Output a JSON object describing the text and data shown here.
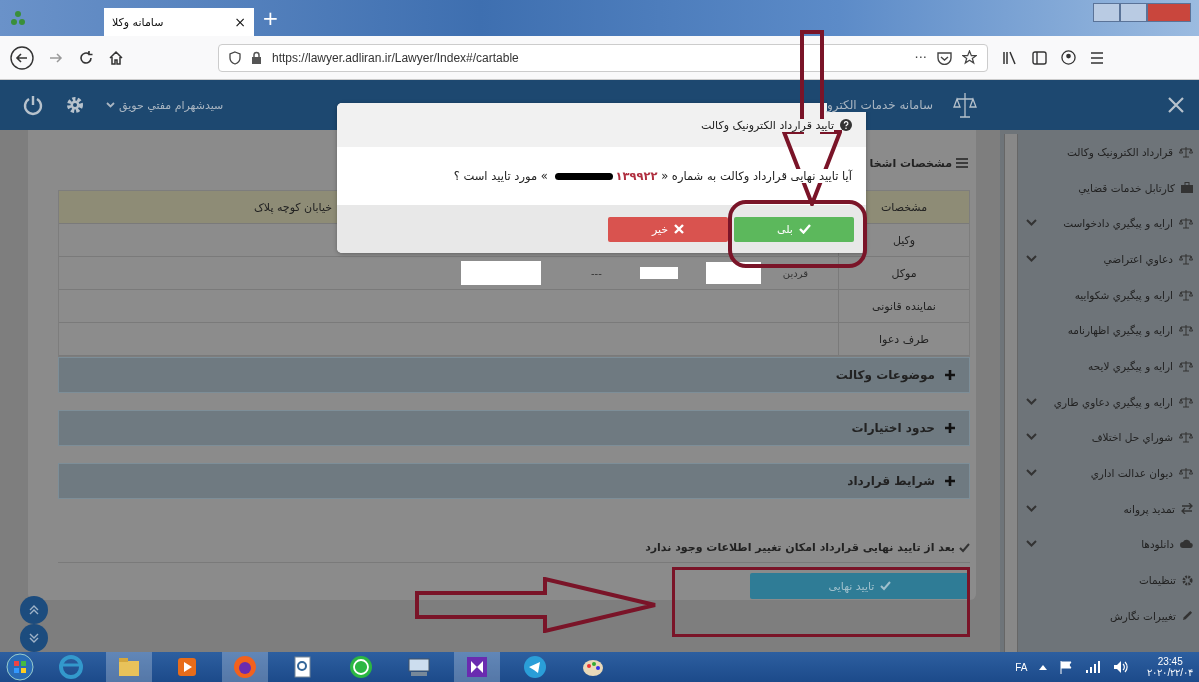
{
  "browser": {
    "tab_title": "سامانه وکلا",
    "tab_close": "×",
    "new_tab": "+",
    "url": "https://lawyer.adliran.ir/Lawyer/Index#/cartable",
    "more": "···"
  },
  "header": {
    "user": "سیدشهرام مفتي حويق",
    "system": "سامانه خدمات الکترو"
  },
  "sidebar": {
    "items": [
      {
        "label": "قرارداد الکترونیک وکالت",
        "kind": "scales",
        "expandable": false
      },
      {
        "label": "کارتابل خدمات قضايي",
        "kind": "briefcase",
        "expandable": false
      },
      {
        "label": "ارايه و پيگيري دادخواست",
        "kind": "scales",
        "expandable": true
      },
      {
        "label": "دعاوي اعتراضي",
        "kind": "scales",
        "expandable": true
      },
      {
        "label": "ارايه و پيگيري شكواييه",
        "kind": "scales",
        "expandable": false
      },
      {
        "label": "ارايه و پيگيري اظهارنامه",
        "kind": "scales",
        "expandable": false
      },
      {
        "label": "ارايه و پيگيري لايحه",
        "kind": "scales",
        "expandable": false
      },
      {
        "label": "ارايه و پيگيري دعاوي طاري",
        "kind": "scales",
        "expandable": true
      },
      {
        "label": "شوراي حل اختلاف",
        "kind": "scales",
        "expandable": true
      },
      {
        "label": "ديوان عدالت اداري",
        "kind": "scales",
        "expandable": true
      },
      {
        "label": "تمدید پروانه",
        "kind": "exchange",
        "expandable": true
      },
      {
        "label": "دانلودها",
        "kind": "cloud",
        "expandable": true
      },
      {
        "label": "تنظیمات",
        "kind": "gear",
        "expandable": false
      },
      {
        "label": "تغییرات نگارش",
        "kind": "pencil",
        "expandable": false
      }
    ]
  },
  "panel": {
    "title": "مشخصات اشخا",
    "columns": [
      "مشخصات",
      "خیابان کوچه پلاک"
    ],
    "rows": [
      {
        "label": "وکیل",
        "cells": []
      },
      {
        "label": "موکل",
        "cells": [
          "قردین",
          "---"
        ]
      },
      {
        "label": "نماینده قانونی",
        "cells": []
      },
      {
        "label": "طرف دعوا",
        "cells": []
      }
    ]
  },
  "sections": [
    "موضوعات وکالت",
    "حدود اختیارات",
    "شرایط قرارداد"
  ],
  "note": "بعد از تایید نهایی قرارداد امکان تغییر اطلاعات وجود ندارد",
  "final_button": {
    "label": "تایید نهایی",
    "disabled": true
  },
  "dialog": {
    "title": "تایید قرارداد الکترونیک وکالت",
    "message_before": "آیا تایید نهایی قرارداد وکالت به شماره «",
    "number": "۱۳۹۹۲۲",
    "message_after": "» مورد تایید است ؟",
    "buttons": [
      {
        "label": "بلی",
        "kind": "confirm"
      },
      {
        "label": "خیر",
        "kind": "cancel"
      }
    ]
  },
  "taskbar": {
    "language": "FA",
    "time": "23:45",
    "date": "۲۰۲۰/۲۲/۰۴"
  }
}
